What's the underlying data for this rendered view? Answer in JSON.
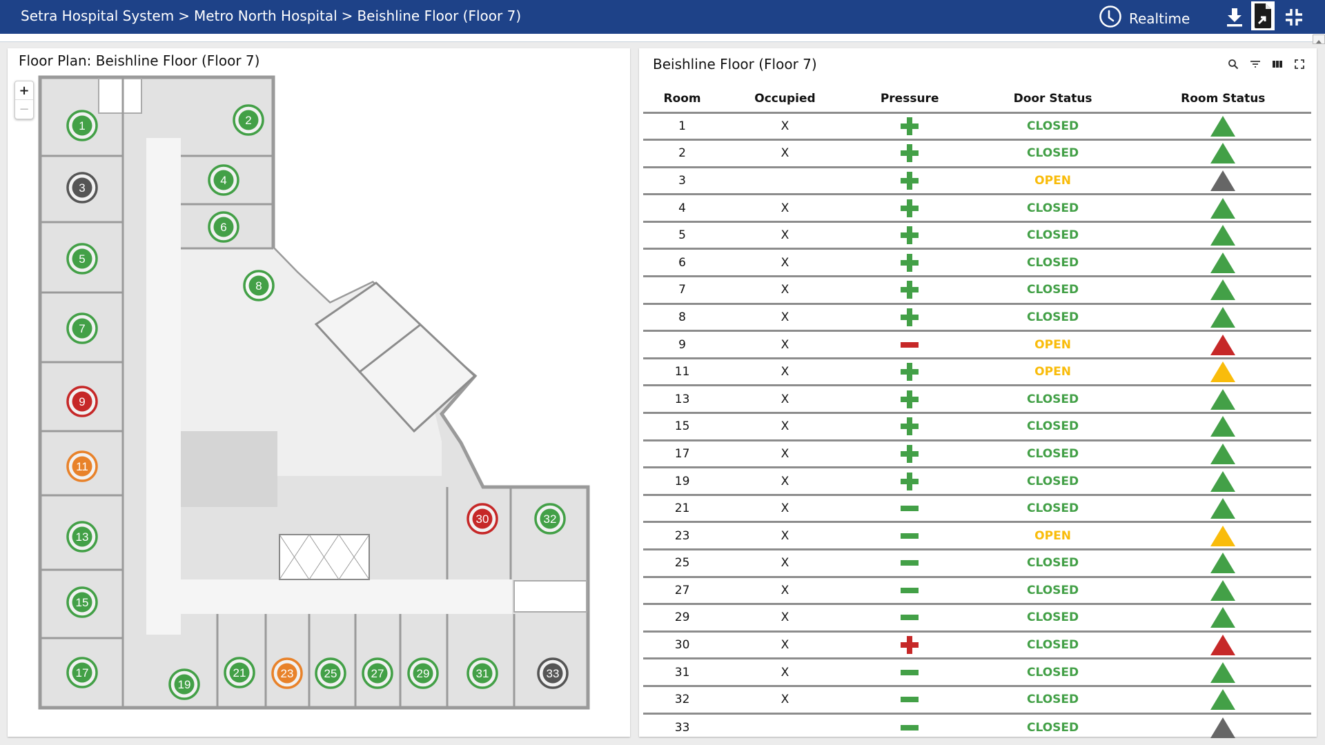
{
  "topbar": {
    "breadcrumb": [
      "Setra Hospital System",
      "Metro North Hospital",
      "Beishline Floor (Floor 7)"
    ],
    "separator": ">",
    "mode_label": "Realtime",
    "icons": [
      "clock-icon",
      "download-icon",
      "export-file-icon",
      "exit-fullscreen-icon"
    ]
  },
  "map_panel": {
    "title": "Floor Plan: Beishline Floor (Floor 7)",
    "zoom_in_label": "+",
    "zoom_out_label": "−"
  },
  "table_panel": {
    "title": "Beishline Floor (Floor 7)",
    "tools": [
      "search-icon",
      "filter-icon",
      "columns-icon",
      "fullscreen-icon"
    ],
    "columns": [
      "Room",
      "Occupied",
      "Pressure",
      "Door Status",
      "Room Status"
    ]
  },
  "colors": {
    "green": "#43a047",
    "red": "#c62828",
    "orange": "#e8822a",
    "gray": "#555555",
    "amber": "#f9bc0b",
    "header_blue": "#1e4288"
  },
  "rooms": [
    {
      "room": "1",
      "occupied": "X",
      "pressure": "positive",
      "pressure_color": "green",
      "door": "CLOSED",
      "status": "green"
    },
    {
      "room": "2",
      "occupied": "X",
      "pressure": "positive",
      "pressure_color": "green",
      "door": "CLOSED",
      "status": "green"
    },
    {
      "room": "3",
      "occupied": "",
      "pressure": "positive",
      "pressure_color": "green",
      "door": "OPEN",
      "status": "gray"
    },
    {
      "room": "4",
      "occupied": "X",
      "pressure": "positive",
      "pressure_color": "green",
      "door": "CLOSED",
      "status": "green"
    },
    {
      "room": "5",
      "occupied": "X",
      "pressure": "positive",
      "pressure_color": "green",
      "door": "CLOSED",
      "status": "green"
    },
    {
      "room": "6",
      "occupied": "X",
      "pressure": "positive",
      "pressure_color": "green",
      "door": "CLOSED",
      "status": "green"
    },
    {
      "room": "7",
      "occupied": "X",
      "pressure": "positive",
      "pressure_color": "green",
      "door": "CLOSED",
      "status": "green"
    },
    {
      "room": "8",
      "occupied": "X",
      "pressure": "positive",
      "pressure_color": "green",
      "door": "CLOSED",
      "status": "green"
    },
    {
      "room": "9",
      "occupied": "X",
      "pressure": "negative",
      "pressure_color": "red",
      "door": "OPEN",
      "status": "red"
    },
    {
      "room": "11",
      "occupied": "X",
      "pressure": "positive",
      "pressure_color": "green",
      "door": "OPEN",
      "status": "amber"
    },
    {
      "room": "13",
      "occupied": "X",
      "pressure": "positive",
      "pressure_color": "green",
      "door": "CLOSED",
      "status": "green"
    },
    {
      "room": "15",
      "occupied": "X",
      "pressure": "positive",
      "pressure_color": "green",
      "door": "CLOSED",
      "status": "green"
    },
    {
      "room": "17",
      "occupied": "X",
      "pressure": "positive",
      "pressure_color": "green",
      "door": "CLOSED",
      "status": "green"
    },
    {
      "room": "19",
      "occupied": "X",
      "pressure": "positive",
      "pressure_color": "green",
      "door": "CLOSED",
      "status": "green"
    },
    {
      "room": "21",
      "occupied": "X",
      "pressure": "negative",
      "pressure_color": "green",
      "door": "CLOSED",
      "status": "green"
    },
    {
      "room": "23",
      "occupied": "X",
      "pressure": "negative",
      "pressure_color": "green",
      "door": "OPEN",
      "status": "amber"
    },
    {
      "room": "25",
      "occupied": "X",
      "pressure": "negative",
      "pressure_color": "green",
      "door": "CLOSED",
      "status": "green"
    },
    {
      "room": "27",
      "occupied": "X",
      "pressure": "negative",
      "pressure_color": "green",
      "door": "CLOSED",
      "status": "green"
    },
    {
      "room": "29",
      "occupied": "X",
      "pressure": "negative",
      "pressure_color": "green",
      "door": "CLOSED",
      "status": "green"
    },
    {
      "room": "30",
      "occupied": "X",
      "pressure": "positive",
      "pressure_color": "red",
      "door": "CLOSED",
      "status": "red"
    },
    {
      "room": "31",
      "occupied": "X",
      "pressure": "negative",
      "pressure_color": "green",
      "door": "CLOSED",
      "status": "green"
    },
    {
      "room": "32",
      "occupied": "X",
      "pressure": "negative",
      "pressure_color": "green",
      "door": "CLOSED",
      "status": "green"
    },
    {
      "room": "33",
      "occupied": "",
      "pressure": "negative",
      "pressure_color": "green",
      "door": "CLOSED",
      "status": "gray"
    }
  ],
  "map_markers": [
    {
      "label": "1",
      "color": "green"
    },
    {
      "label": "2",
      "color": "green"
    },
    {
      "label": "3",
      "color": "gray"
    },
    {
      "label": "4",
      "color": "green"
    },
    {
      "label": "5",
      "color": "green"
    },
    {
      "label": "6",
      "color": "green"
    },
    {
      "label": "7",
      "color": "green"
    },
    {
      "label": "8",
      "color": "green"
    },
    {
      "label": "9",
      "color": "red"
    },
    {
      "label": "11",
      "color": "orange"
    },
    {
      "label": "13",
      "color": "green"
    },
    {
      "label": "15",
      "color": "green"
    },
    {
      "label": "17",
      "color": "green"
    },
    {
      "label": "19",
      "color": "green"
    },
    {
      "label": "21",
      "color": "green"
    },
    {
      "label": "23",
      "color": "orange"
    },
    {
      "label": "25",
      "color": "green"
    },
    {
      "label": "27",
      "color": "green"
    },
    {
      "label": "29",
      "color": "green"
    },
    {
      "label": "30",
      "color": "red"
    },
    {
      "label": "31",
      "color": "green"
    },
    {
      "label": "32",
      "color": "green"
    },
    {
      "label": "33",
      "color": "gray"
    }
  ]
}
